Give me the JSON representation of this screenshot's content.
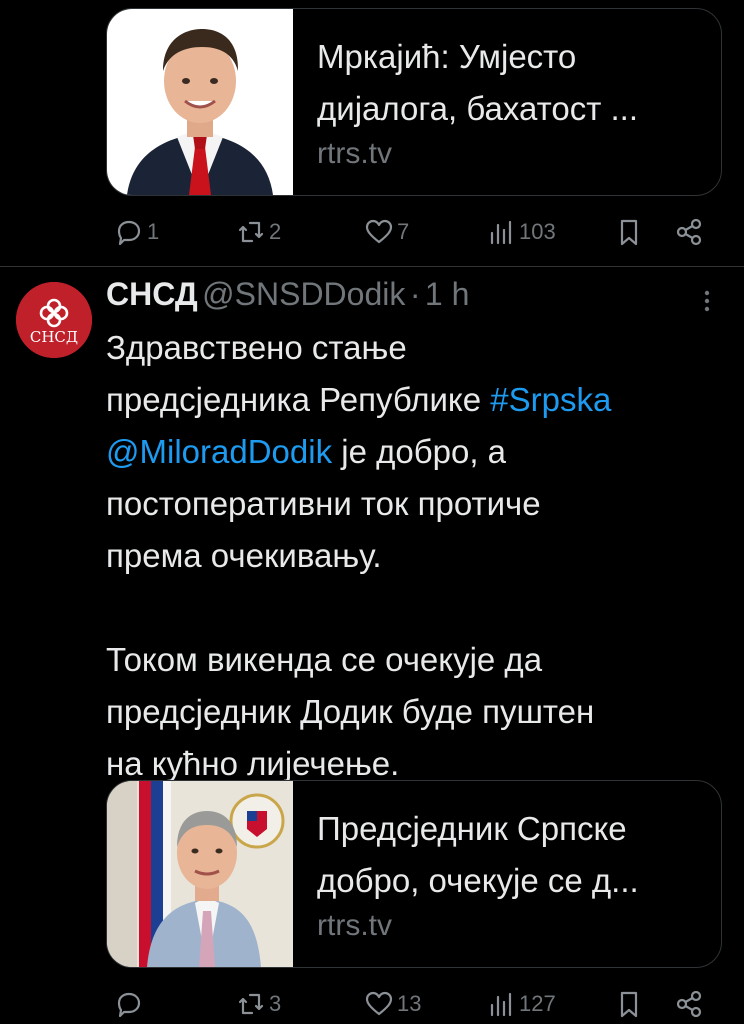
{
  "card_top": {
    "title": "Мркајић: Умјесто дијалога, бахатост ...",
    "domain": "rtrs.tv"
  },
  "actions_top": {
    "replies": "1",
    "reposts": "2",
    "likes": "7",
    "views": "103"
  },
  "tweet": {
    "avatar_text": "СНСД",
    "name": "СНСД",
    "handle": "@SNSDDodik",
    "separator": "·",
    "time": "1 h",
    "line1": "Здравствено стање",
    "line2_pre": "предсједника Републике ",
    "hashtag": "#Srpska",
    "mention": "@MiloradDodik",
    "line3_post": " је добро, а",
    "line4": "постоперативни ток протиче",
    "line5": "према очекивању.",
    "line6": "Током викенда се очекује да",
    "line7": "предсједник Додик буде пуштен",
    "line8": "на кућно лијечење."
  },
  "card_bottom": {
    "title": "Предсједник Српске добро, очекује се д...",
    "domain": "rtrs.tv"
  },
  "actions_bottom": {
    "replies": "",
    "reposts": "3",
    "likes": "13",
    "views": "127"
  },
  "colors": {
    "background": "#000000",
    "text": "#e7e9ea",
    "muted": "#71767b",
    "link": "#1d9bf0",
    "border": "#2f3336",
    "avatar": "#c0202a"
  }
}
